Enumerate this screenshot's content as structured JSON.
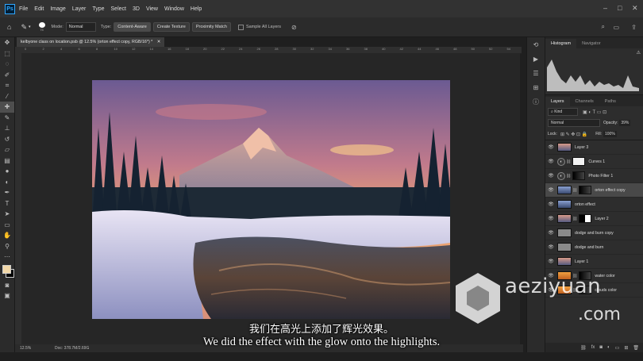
{
  "app": {
    "logo": "Ps"
  },
  "menu": [
    "File",
    "Edit",
    "Image",
    "Layer",
    "Type",
    "Select",
    "3D",
    "View",
    "Window",
    "Help"
  ],
  "window_controls": [
    "minimize-icon",
    "restore-icon",
    "close-icon"
  ],
  "options": {
    "brush_size": "75",
    "mode_label": "Mode:",
    "mode_value": "Normal",
    "type_label": "Type:",
    "type_options": [
      "Content-Aware",
      "Create Texture",
      "Proximity Match"
    ],
    "sample_all_layers": "Sample All Layers"
  },
  "document": {
    "tab_title": "kelbyone class on location.psb @ 12.5% (orton effect copy, RGB/16*) *",
    "ruler_ticks": [
      "0",
      "2",
      "4",
      "6",
      "8",
      "10",
      "12",
      "14",
      "16",
      "18",
      "20",
      "22",
      "24",
      "26",
      "28",
      "30",
      "32",
      "34",
      "36",
      "38",
      "40",
      "42",
      "44",
      "46",
      "48",
      "50",
      "52",
      "54"
    ]
  },
  "status": {
    "zoom": "12.5%",
    "doc": "Doc: 378.7M/2.69G"
  },
  "subtitles": {
    "cn": "我们在高光上添加了辉光效果。",
    "en": "We did the effect with the glow onto the highlights."
  },
  "panels": {
    "top_tabs": [
      "Histogram",
      "Navigator"
    ],
    "layer_tabs": [
      "Layers",
      "Channels",
      "Paths"
    ],
    "filter_kind": "Kind",
    "blend_mode": "Normal",
    "opacity_label": "Opacity:",
    "opacity_value": "39%",
    "lock_label": "Lock:",
    "fill_label": "Fill:",
    "fill_value": "100%",
    "layers": [
      {
        "name": "Layer 3",
        "type": "pixel",
        "thumb": "photo"
      },
      {
        "name": "Curves 1",
        "type": "adjustment",
        "mask": "white"
      },
      {
        "name": "Photo Filter 1",
        "type": "adjustment",
        "mask": "dark"
      },
      {
        "name": "orton effect copy",
        "type": "pixel",
        "thumb": "photo-blue",
        "mask": "dark",
        "selected": true
      },
      {
        "name": "orton effect",
        "type": "pixel",
        "thumb": "photo-blue"
      },
      {
        "name": "Layer 2",
        "type": "pixel",
        "thumb": "photo",
        "mask": "black-white"
      },
      {
        "name": "dodge and burn copy",
        "type": "pixel",
        "thumb": "gray"
      },
      {
        "name": "dodge and burn",
        "type": "pixel",
        "thumb": "gray"
      },
      {
        "name": "Layer 1",
        "type": "pixel",
        "thumb": "photo"
      },
      {
        "name": "water color",
        "type": "pixel",
        "thumb": "orange",
        "mask": "dark"
      },
      {
        "name": "clouds color",
        "type": "pixel",
        "thumb": "orange",
        "mask": "dark"
      }
    ]
  },
  "watermark": {
    "line1": "aeziyuan",
    "line2": ".com"
  },
  "colors": {
    "accent": "#31a8ff",
    "menu_bg": "#323232",
    "panel_bg": "#2d2d2d",
    "canvas_bg": "#262626"
  }
}
